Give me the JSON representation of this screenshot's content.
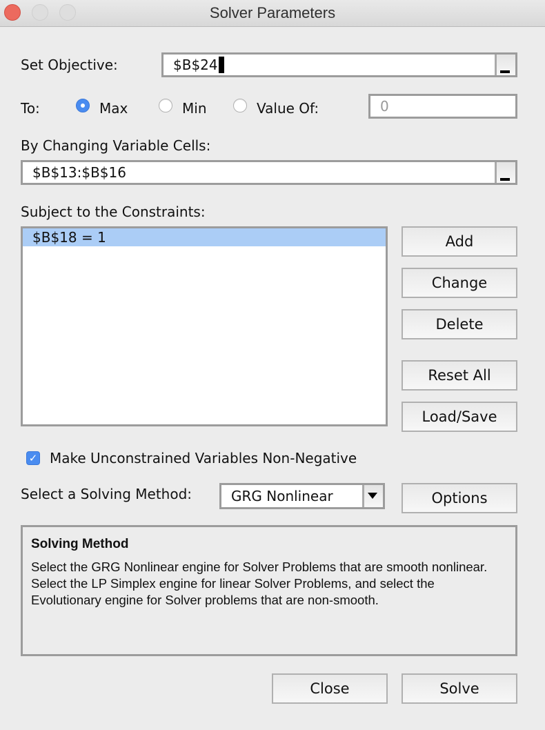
{
  "window": {
    "title": "Solver Parameters",
    "controls": [
      "close",
      "minimize",
      "maximize"
    ]
  },
  "objective": {
    "label": "Set Objective:",
    "value": "$B$24"
  },
  "to": {
    "label": "To:",
    "options": [
      {
        "label": "Max",
        "selected": true
      },
      {
        "label": "Min",
        "selected": false
      },
      {
        "label": "Value Of:",
        "selected": false
      }
    ],
    "value_of": "0"
  },
  "variable_cells": {
    "label": "By Changing Variable Cells:",
    "value": "$B$13:$B$16"
  },
  "constraints": {
    "label": "Subject to the Constraints:",
    "items": [
      "$B$18 = 1"
    ],
    "selected_index": 0
  },
  "buttons": {
    "add": "Add",
    "change": "Change",
    "delete": "Delete",
    "reset_all": "Reset All",
    "load_save": "Load/Save",
    "options": "Options",
    "close": "Close",
    "solve": "Solve"
  },
  "non_negative": {
    "label": "Make Unconstrained Variables Non-Negative",
    "checked": true
  },
  "method": {
    "label": "Select a Solving Method:",
    "selected": "GRG Nonlinear"
  },
  "description": {
    "title": "Solving Method",
    "body": "Select the GRG Nonlinear engine for Solver Problems that are smooth nonlinear. Select the LP Simplex engine for linear Solver Problems, and select the Evolutionary engine for Solver problems that are non-smooth."
  },
  "colors": {
    "accent": "#4a8cf0",
    "selection": "#abcdf6",
    "close_light": "#ec6a5e"
  }
}
